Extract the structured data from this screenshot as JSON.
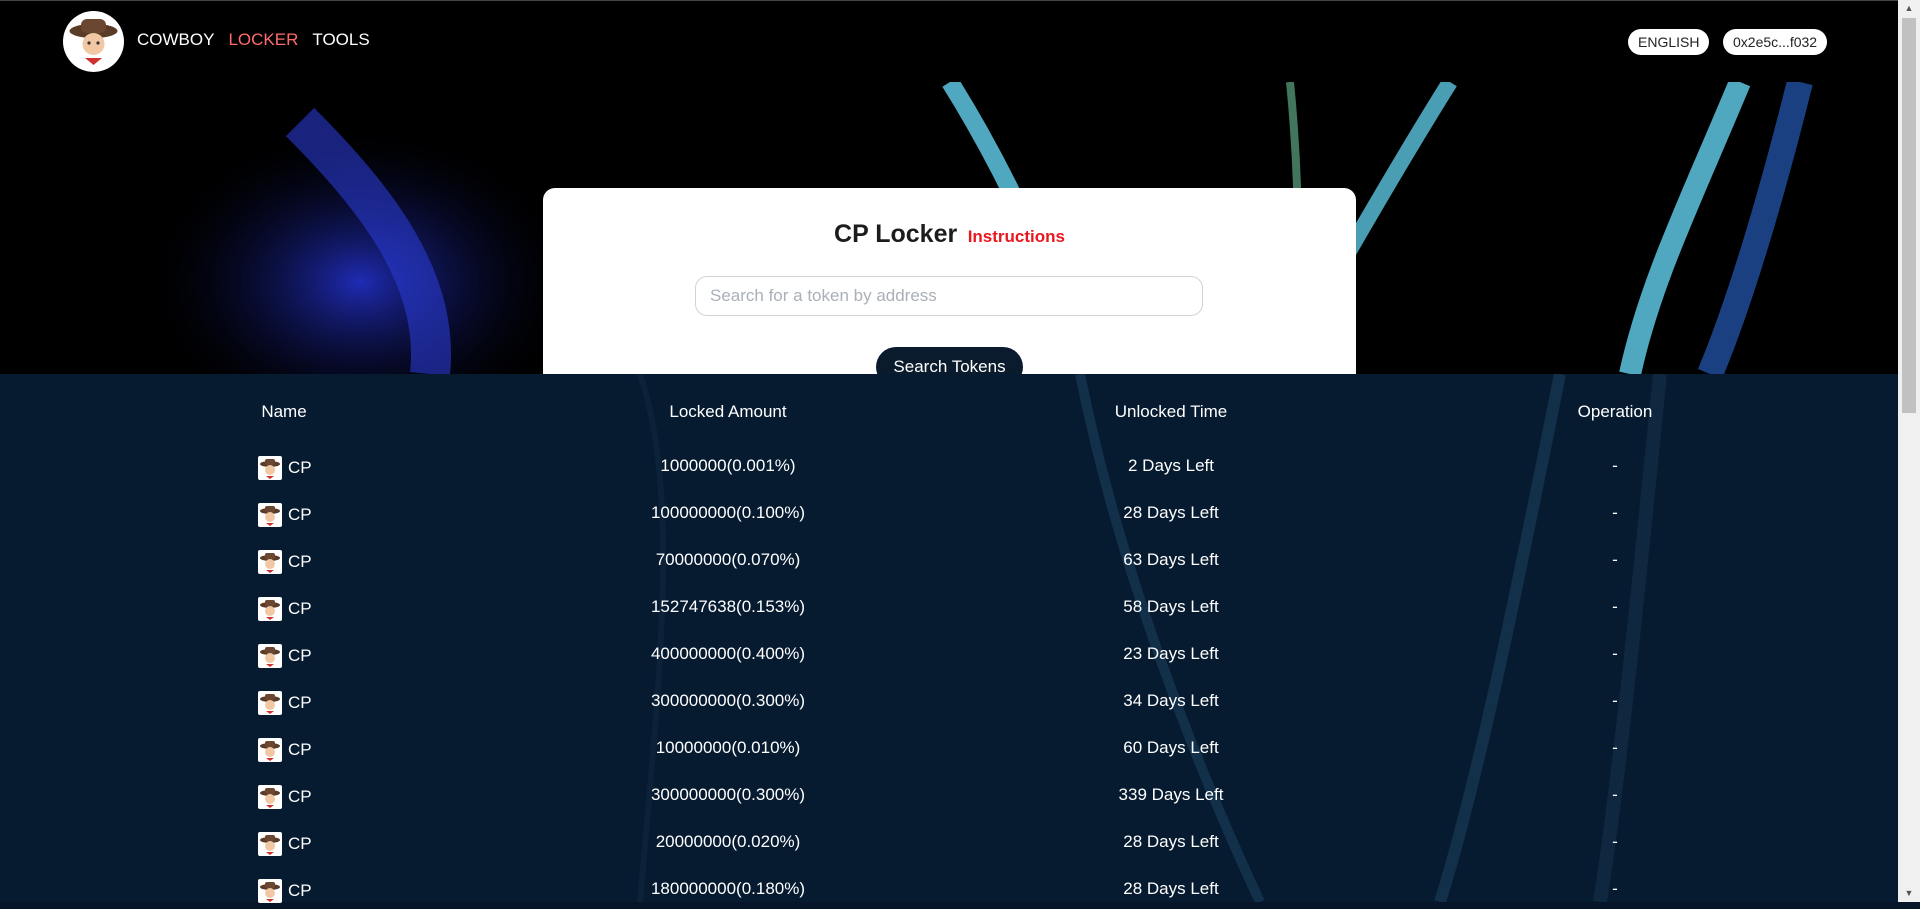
{
  "nav": {
    "links": [
      "COWBOY",
      "LOCKER",
      "TOOLS"
    ],
    "active_link": "LOCKER",
    "language": "ENGLISH",
    "wallet": "0x2e5c...f032",
    "accent_color": "#ff6b6b"
  },
  "card": {
    "title": "CP Locker",
    "instructions": "Instructions",
    "search_placeholder": "Search for a token by address",
    "search_value": "",
    "search_button": "Search Tokens"
  },
  "table": {
    "headers": [
      "Name",
      "Locked Amount",
      "Unlocked Time",
      "Operation"
    ],
    "rows": [
      {
        "name": "CP",
        "amount": "1000000(0.001%)",
        "time": "2 Days Left",
        "op": "-"
      },
      {
        "name": "CP",
        "amount": "100000000(0.100%)",
        "time": "28 Days Left",
        "op": "-"
      },
      {
        "name": "CP",
        "amount": "70000000(0.070%)",
        "time": "63 Days Left",
        "op": "-"
      },
      {
        "name": "CP",
        "amount": "152747638(0.153%)",
        "time": "58 Days Left",
        "op": "-"
      },
      {
        "name": "CP",
        "amount": "400000000(0.400%)",
        "time": "23 Days Left",
        "op": "-"
      },
      {
        "name": "CP",
        "amount": "300000000(0.300%)",
        "time": "34 Days Left",
        "op": "-"
      },
      {
        "name": "CP",
        "amount": "10000000(0.010%)",
        "time": "60 Days Left",
        "op": "-"
      },
      {
        "name": "CP",
        "amount": "300000000(0.300%)",
        "time": "339 Days Left",
        "op": "-"
      },
      {
        "name": "CP",
        "amount": "20000000(0.020%)",
        "time": "28 Days Left",
        "op": "-"
      },
      {
        "name": "CP",
        "amount": "180000000(0.180%)",
        "time": "28 Days Left",
        "op": "-"
      }
    ]
  }
}
